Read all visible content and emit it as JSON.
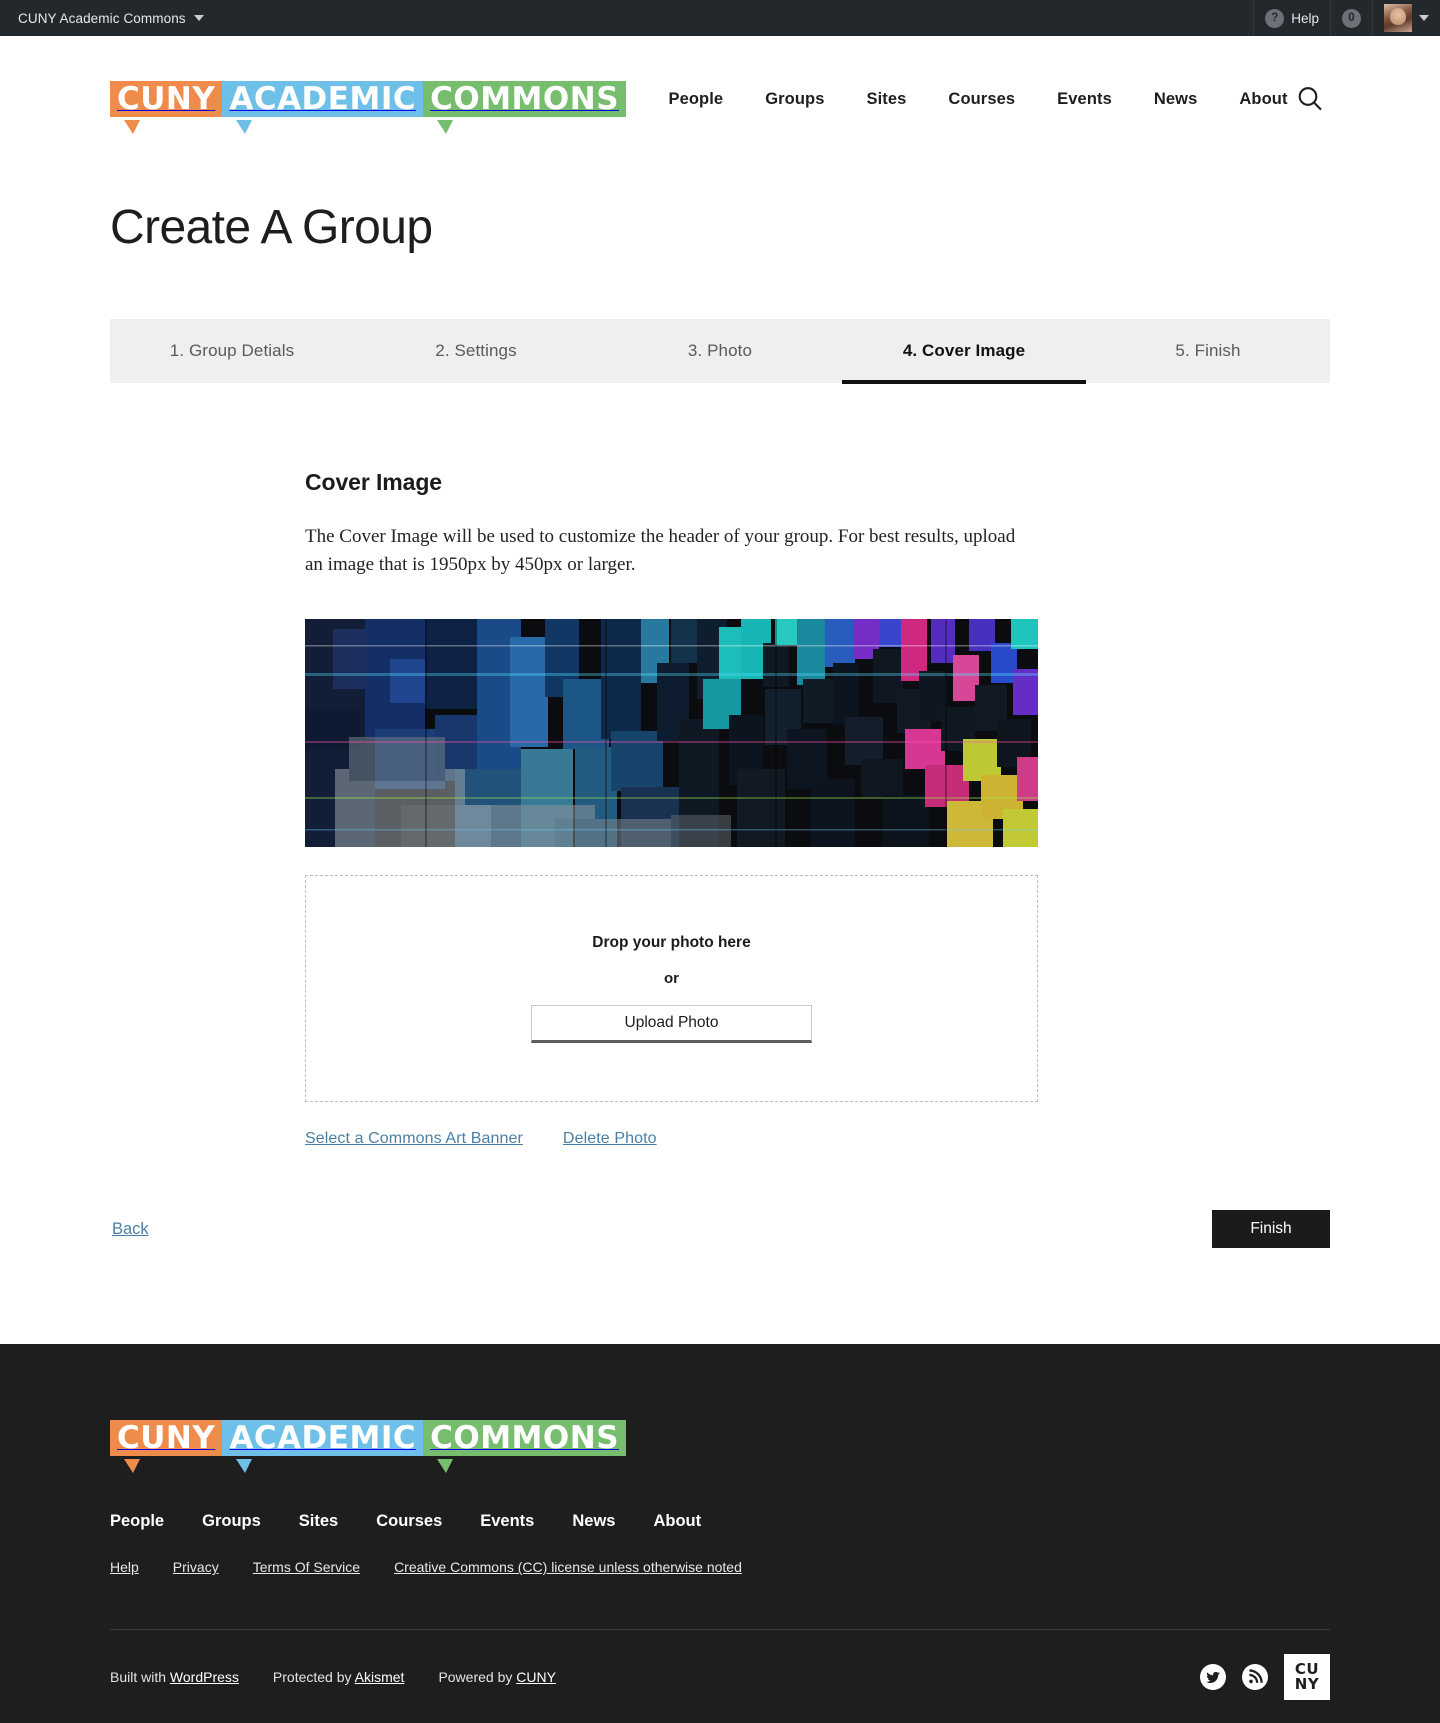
{
  "adminbar": {
    "site_name": "CUNY Academic Commons",
    "help_label": "Help",
    "notification_count": "0",
    "help_icon": "question-mark-icon",
    "caret_icon": "chevron-down-icon"
  },
  "header": {
    "logo": {
      "part1": "CUNY",
      "part2": "ACADEMIC",
      "part3": "COMMONS"
    },
    "nav": [
      {
        "label": "People"
      },
      {
        "label": "Groups"
      },
      {
        "label": "Sites"
      },
      {
        "label": "Courses"
      },
      {
        "label": "Events"
      },
      {
        "label": "News"
      },
      {
        "label": "About"
      }
    ],
    "search_icon": "search-icon"
  },
  "page": {
    "title": "Create A Group"
  },
  "wizard": {
    "tabs": [
      {
        "label": "1. Group Detials",
        "active": false
      },
      {
        "label": "2. Settings",
        "active": false
      },
      {
        "label": "3. Photo",
        "active": false
      },
      {
        "label": "4. Cover Image",
        "active": true
      },
      {
        "label": "5. Finish",
        "active": false
      }
    ]
  },
  "cover_step": {
    "heading": "Cover Image",
    "description": "The Cover Image will be used to customize the header of your group. For best results, upload an image that is 1950px by 450px or larger.",
    "preview_alt": "glitch-art-cover-image-preview",
    "dropzone": {
      "title": "Drop your photo here",
      "or": "or",
      "upload_button": "Upload Photo"
    },
    "links": [
      {
        "label": "Select a Commons Art Banner"
      },
      {
        "label": "Delete Photo"
      }
    ]
  },
  "form_nav": {
    "back_label": "Back",
    "finish_label": "Finish"
  },
  "footer": {
    "logo": {
      "part1": "CUNY",
      "part2": "ACADEMIC",
      "part3": "COMMONS"
    },
    "nav": [
      {
        "label": "People"
      },
      {
        "label": "Groups"
      },
      {
        "label": "Sites"
      },
      {
        "label": "Courses"
      },
      {
        "label": "Events"
      },
      {
        "label": "News"
      },
      {
        "label": "About"
      }
    ],
    "legal": [
      {
        "label": "Help"
      },
      {
        "label": "Privacy"
      },
      {
        "label": "Terms Of Service"
      },
      {
        "label": "Creative Commons (CC) license unless otherwise noted"
      }
    ],
    "credits": [
      {
        "prefix": "Built with",
        "link": "WordPress"
      },
      {
        "prefix": "Protected by",
        "link": "Akismet"
      },
      {
        "prefix": "Powered by",
        "link": "CUNY"
      }
    ],
    "social": [
      {
        "name": "twitter-icon"
      },
      {
        "name": "rss-icon"
      }
    ],
    "cuny_mark": {
      "line1": "CU",
      "line2": "NY"
    }
  },
  "colors": {
    "logo_orange": "#f08c4b",
    "logo_blue": "#6ec0e8",
    "logo_green": "#76bd6d",
    "link_blue": "#4a7fa5",
    "dark": "#1e1e1e",
    "tab_bg": "#efefef"
  }
}
